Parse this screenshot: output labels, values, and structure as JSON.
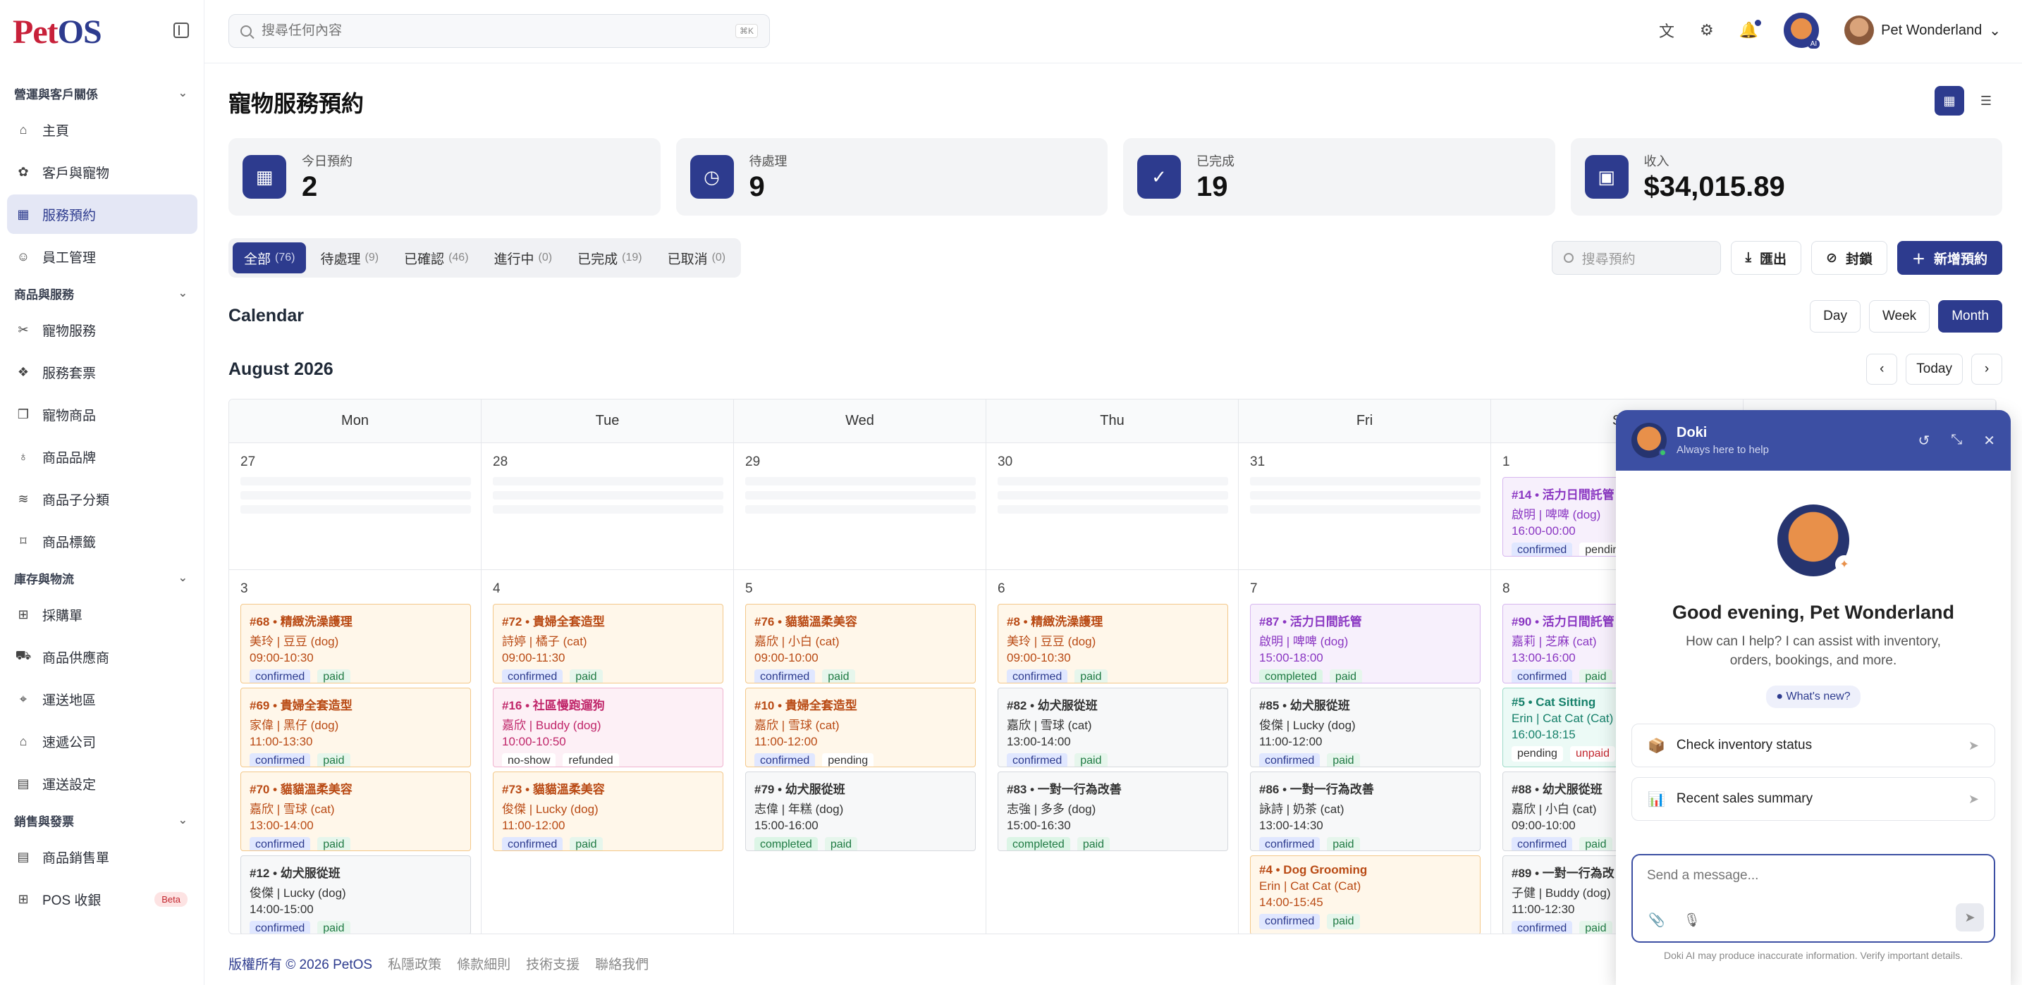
{
  "brand": {
    "logo_pet": "Pet",
    "logo_os": "OS"
  },
  "search": {
    "placeholder": "搜尋任何內容",
    "shortcut": "⌘K"
  },
  "user": {
    "name": "Pet Wonderland",
    "ai_badge": "AI"
  },
  "sidebar": {
    "sections": [
      {
        "title": "營運與客戶關係",
        "items": [
          {
            "label": "主頁",
            "icon": "home-icon",
            "glyph": "⌂"
          },
          {
            "label": "客戶與寵物",
            "icon": "paw-icon",
            "glyph": "✿"
          },
          {
            "label": "服務預約",
            "icon": "calendar-icon",
            "glyph": "▦",
            "active": true
          },
          {
            "label": "員工管理",
            "icon": "user-icon",
            "glyph": "☺"
          }
        ]
      },
      {
        "title": "商品與服務",
        "items": [
          {
            "label": "寵物服務",
            "icon": "scissors-icon",
            "glyph": "✂"
          },
          {
            "label": "服務套票",
            "icon": "gift-icon",
            "glyph": "❖"
          },
          {
            "label": "寵物商品",
            "icon": "box-icon",
            "glyph": "❒"
          },
          {
            "label": "商品品牌",
            "icon": "award-icon",
            "glyph": "♁"
          },
          {
            "label": "商品子分類",
            "icon": "layers-icon",
            "glyph": "≋"
          },
          {
            "label": "商品標籤",
            "icon": "tag-icon",
            "glyph": "⌑"
          }
        ]
      },
      {
        "title": "庫存與物流",
        "items": [
          {
            "label": "採購單",
            "icon": "cart-icon",
            "glyph": "⊞"
          },
          {
            "label": "商品供應商",
            "icon": "truck-icon",
            "glyph": "⛟"
          },
          {
            "label": "運送地區",
            "icon": "pin-icon",
            "glyph": "⌖"
          },
          {
            "label": "速遞公司",
            "icon": "building-icon",
            "glyph": "⌂"
          },
          {
            "label": "運送設定",
            "icon": "file-icon",
            "glyph": "▤"
          }
        ]
      },
      {
        "title": "銷售與發票",
        "items": [
          {
            "label": "商品銷售單",
            "icon": "receipt-icon",
            "glyph": "▤"
          },
          {
            "label": "POS 收銀",
            "icon": "pos-icon",
            "glyph": "⊞",
            "badge": "Beta"
          }
        ]
      }
    ]
  },
  "page": {
    "title": "寵物服務預約"
  },
  "stats": [
    {
      "label": "今日預約",
      "value": "2",
      "icon": "calendar-icon",
      "glyph": "▦"
    },
    {
      "label": "待處理",
      "value": "9",
      "icon": "clock-icon",
      "glyph": "◷"
    },
    {
      "label": "已完成",
      "value": "19",
      "icon": "check-circle-icon",
      "glyph": "✓"
    },
    {
      "label": "收入",
      "value": "$34,015.89",
      "icon": "wallet-icon",
      "glyph": "▣"
    }
  ],
  "tabs": [
    {
      "label": "全部",
      "count": "(76)",
      "active": true
    },
    {
      "label": "待處理",
      "count": "(9)"
    },
    {
      "label": "已確認",
      "count": "(46)"
    },
    {
      "label": "進行中",
      "count": "(0)"
    },
    {
      "label": "已完成",
      "count": "(19)"
    },
    {
      "label": "已取消",
      "count": "(0)"
    }
  ],
  "actions": {
    "search_placeholder": "搜尋預約",
    "export": "匯出",
    "block": "封鎖",
    "new": "新增預約"
  },
  "calendar": {
    "heading": "Calendar",
    "ranges": [
      "Day",
      "Week",
      "Month"
    ],
    "month_label": "August 2026",
    "today": "Today",
    "weekdays": [
      "Mon",
      "Tue",
      "Wed",
      "Thu",
      "Fri",
      "S"
    ],
    "week1": [
      {
        "day": "27",
        "events": []
      },
      {
        "day": "28",
        "events": []
      },
      {
        "day": "29",
        "events": []
      },
      {
        "day": "30",
        "events": []
      },
      {
        "day": "31",
        "events": []
      },
      {
        "day": "1",
        "events": [
          {
            "title": "#14 • 活力日間託管",
            "pet": "啟明 | 啤啤 (dog)",
            "time": "16:00-00:00",
            "tags": [
              "confirmed",
              "pending"
            ],
            "color": "purple"
          }
        ]
      },
      {
        "day": "",
        "events": []
      }
    ],
    "week2": [
      {
        "day": "3",
        "events": [
          {
            "title": "#68 • 精緻洗澡護理",
            "pet": "美玲 | 豆豆 (dog)",
            "time": "09:00-10:30",
            "tags": [
              "confirmed",
              "paid"
            ],
            "color": "orange"
          },
          {
            "title": "#69 • 貴婦全套造型",
            "pet": "家偉 | 黑仔 (dog)",
            "time": "11:00-13:30",
            "tags": [
              "confirmed",
              "paid"
            ],
            "color": "orange"
          },
          {
            "title": "#70 • 貓貓溫柔美容",
            "pet": "嘉欣 | 雪球 (cat)",
            "time": "13:00-14:00",
            "tags": [
              "confirmed",
              "paid"
            ],
            "color": "orange"
          },
          {
            "title": "#12 • 幼犬服從班",
            "pet": "俊傑 | Lucky (dog)",
            "time": "14:00-15:00",
            "tags": [
              "confirmed",
              "paid"
            ],
            "color": "gray"
          }
        ]
      },
      {
        "day": "4",
        "events": [
          {
            "title": "#72 • 貴婦全套造型",
            "pet": "詩婷 | 橘子 (cat)",
            "time": "09:00-11:30",
            "tags": [
              "confirmed",
              "paid"
            ],
            "color": "orange"
          },
          {
            "title": "#16 • 社區慢跑遛狗",
            "pet": "嘉欣 | Buddy (dog)",
            "time": "10:00-10:50",
            "tags": [
              "no-show",
              "refunded"
            ],
            "color": "pink"
          },
          {
            "title": "#73 • 貓貓溫柔美容",
            "pet": "俊傑 | Lucky (dog)",
            "time": "11:00-12:00",
            "tags": [
              "confirmed",
              "paid"
            ],
            "color": "orange"
          }
        ]
      },
      {
        "day": "5",
        "events": [
          {
            "title": "#76 • 貓貓溫柔美容",
            "pet": "嘉欣 | 小白 (cat)",
            "time": "09:00-10:00",
            "tags": [
              "confirmed",
              "paid"
            ],
            "color": "orange"
          },
          {
            "title": "#10 • 貴婦全套造型",
            "pet": "嘉欣 | 雪球 (cat)",
            "time": "11:00-12:00",
            "tags": [
              "confirmed",
              "pending"
            ],
            "color": "orange"
          },
          {
            "title": "#79 • 幼犬服從班",
            "pet": "志偉 | 年糕 (dog)",
            "time": "15:00-16:00",
            "tags": [
              "completed",
              "paid"
            ],
            "color": "gray"
          }
        ]
      },
      {
        "day": "6",
        "events": [
          {
            "title": "#8 • 精緻洗澡護理",
            "pet": "美玲 | 豆豆 (dog)",
            "time": "09:00-10:30",
            "tags": [
              "confirmed",
              "paid"
            ],
            "color": "orange"
          },
          {
            "title": "#82 • 幼犬服從班",
            "pet": "嘉欣 | 雪球 (cat)",
            "time": "13:00-14:00",
            "tags": [
              "confirmed",
              "paid"
            ],
            "color": "gray"
          },
          {
            "title": "#83 • 一對一行為改善",
            "pet": "志強 | 多多 (dog)",
            "time": "15:00-16:30",
            "tags": [
              "completed",
              "paid"
            ],
            "color": "gray"
          }
        ]
      },
      {
        "day": "7",
        "events": [
          {
            "title": "#87 • 活力日間託管",
            "pet": "啟明 | 啤啤 (dog)",
            "time": "15:00-18:00",
            "tags": [
              "completed",
              "paid"
            ],
            "color": "purple"
          },
          {
            "title": "#85 • 幼犬服從班",
            "pet": "俊傑 | Lucky (dog)",
            "time": "11:00-12:00",
            "tags": [
              "confirmed",
              "paid"
            ],
            "color": "gray"
          },
          {
            "title": "#86 • 一對一行為改善",
            "pet": "詠詩 | 奶茶 (cat)",
            "time": "13:00-14:30",
            "tags": [
              "confirmed",
              "paid"
            ],
            "color": "gray"
          },
          {
            "title": "#4 • Dog Grooming",
            "pet": "Erin | Cat Cat (Cat)",
            "time": "14:00-15:45",
            "tags": [
              "confirmed",
              "paid"
            ],
            "color": "orange"
          }
        ]
      },
      {
        "day": "8",
        "events": [
          {
            "title": "#90 • 活力日間託管",
            "pet": "嘉莉 | 芝麻 (cat)",
            "time": "13:00-16:00",
            "tags": [
              "confirmed",
              "paid"
            ],
            "color": "purple"
          },
          {
            "title": "#5 • Cat Sitting",
            "pet": "Erin | Cat Cat (Cat)",
            "time": "16:00-18:15",
            "tags": [
              "pending",
              "unpaid"
            ],
            "color": "teal"
          },
          {
            "title": "#88 • 幼犬服從班",
            "pet": "嘉欣 | 小白 (cat)",
            "time": "09:00-10:00",
            "tags": [
              "confirmed",
              "paid"
            ],
            "color": "gray"
          },
          {
            "title": "#89 • 一對一行為改",
            "pet": "子健 | Buddy (dog)",
            "time": "11:00-12:30",
            "tags": [
              "confirmed",
              "paid"
            ],
            "color": "gray"
          }
        ]
      },
      {
        "day": "",
        "events": []
      }
    ]
  },
  "footer": {
    "copyright": "版權所有 © 2026 PetOS",
    "links": [
      "私隱政策",
      "條款細則",
      "技術支援",
      "聯絡我們"
    ]
  },
  "chat": {
    "name": "Doki",
    "subtitle": "Always here to help",
    "greeting": "Good evening, Pet Wonderland",
    "help_text": "How can I help? I can assist with inventory, orders, bookings, and more.",
    "whats_new": "What's new?",
    "suggestions": [
      {
        "label": "Check inventory status",
        "icon": "package-icon",
        "glyph": "📦"
      },
      {
        "label": "Recent sales summary",
        "icon": "bar-chart-icon",
        "glyph": "📊"
      }
    ],
    "input_placeholder": "Send a message...",
    "disclaimer": "Doki AI may produce inaccurate information. Verify important details."
  }
}
